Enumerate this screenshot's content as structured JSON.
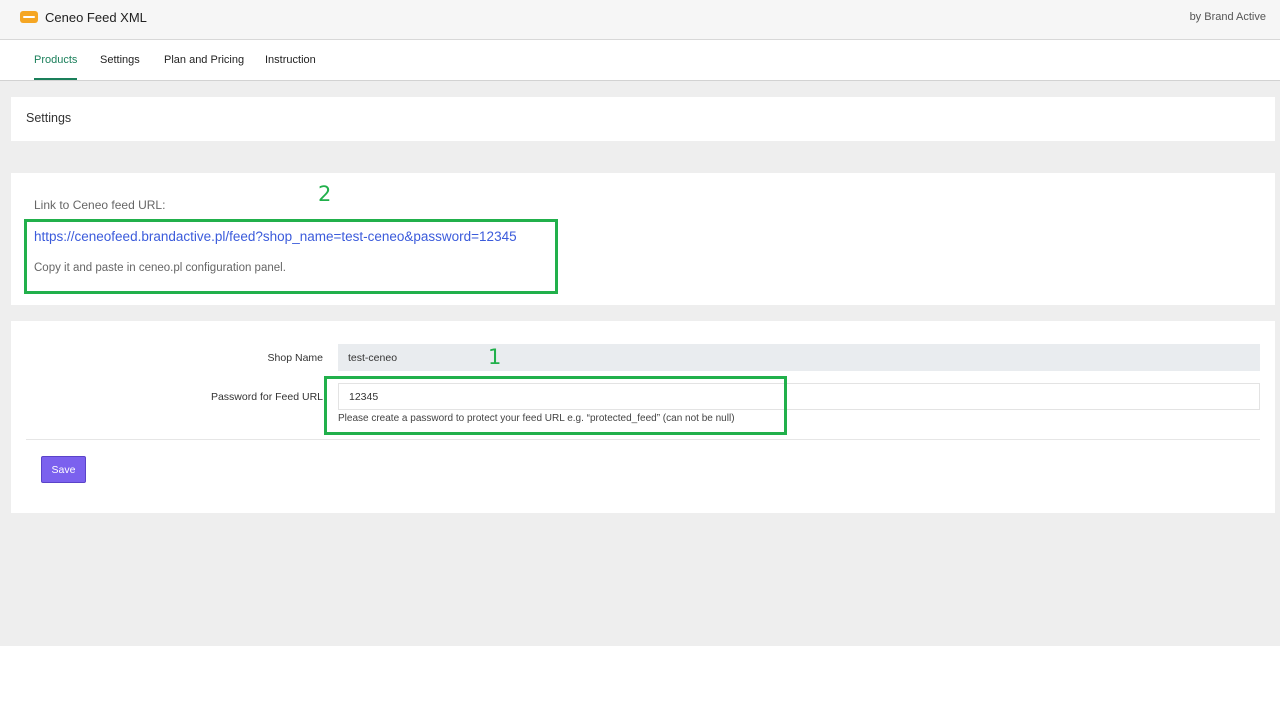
{
  "header": {
    "app_title": "Ceneo Feed XML",
    "brand": "by Brand Active",
    "logo_icon": "ceneo-logo-icon"
  },
  "tabs": [
    {
      "label": "Products",
      "active": true
    },
    {
      "label": "Settings",
      "active": false
    },
    {
      "label": "Plan and Pricing",
      "active": false
    },
    {
      "label": "Instruction",
      "active": false
    }
  ],
  "settings_card": {
    "title": "Settings"
  },
  "link_card": {
    "label": "Link to Ceneo feed URL:",
    "url": "https://ceneofeed.brandactive.pl/feed?shop_name=test-ceneo&password=12345",
    "help": "Copy it and paste in ceneo.pl configuration panel."
  },
  "form": {
    "shop_name_label": "Shop Name",
    "shop_name_value": "test-ceneo",
    "password_label": "Password for Feed URL",
    "password_value": "12345",
    "password_help": "Please create a password to protect your feed URL e.g. “protected_feed” (can not be null)",
    "save_label": "Save"
  },
  "annotations": {
    "marker_1": "1",
    "marker_2": "2",
    "highlight_color": "#21b04b"
  },
  "colors": {
    "accent_tab": "#1a7f5a",
    "link": "#3b5bdb",
    "save_button": "#7b61ee",
    "logo": "#f5a623"
  }
}
